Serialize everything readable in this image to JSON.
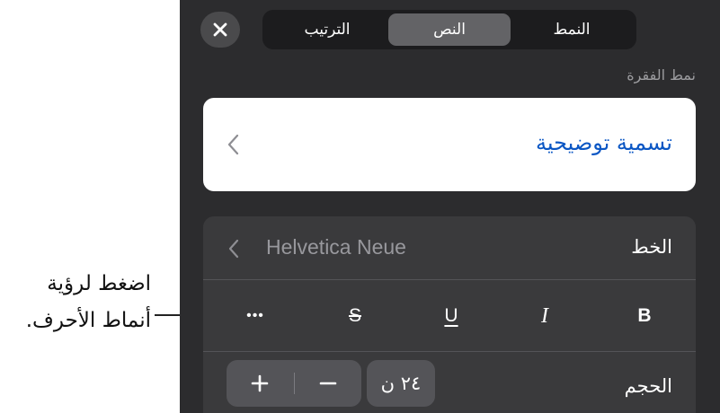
{
  "callout": {
    "line1": "اضغط لرؤية",
    "line2": "أنماط الأحرف."
  },
  "header": {
    "close_icon": "close-icon",
    "tabs": [
      {
        "label": "النمط",
        "selected": false
      },
      {
        "label": "النص",
        "selected": true
      },
      {
        "label": "الترتيب",
        "selected": false
      }
    ]
  },
  "paragraph_style": {
    "section_label": "نمط الفقرة",
    "value": "تسمية توضيحية",
    "chevron_icon": "chevron-left-icon"
  },
  "font": {
    "label": "الخط",
    "value": "Helvetica Neue",
    "chevron_icon": "chevron-left-icon"
  },
  "char_styles": {
    "bold": "B",
    "italic": "I",
    "underline": "U",
    "strikethrough": "S",
    "more": "•••"
  },
  "size": {
    "label": "الحجم",
    "value": "٢٤ ن",
    "plus_icon": "plus-icon",
    "minus_icon": "minus-icon"
  },
  "colors": {
    "panel_bg": "#2c2c2e",
    "accent_blue": "#0a56c4",
    "selected_tab": "#636366"
  }
}
